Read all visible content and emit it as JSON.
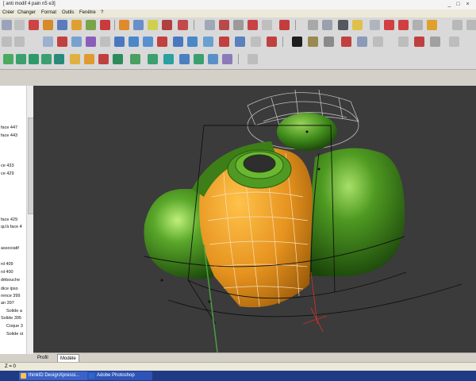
{
  "window": {
    "title": "[ anti modif 4 pain n5 e3]",
    "controls": [
      "_",
      "□",
      "×"
    ]
  },
  "menu": {
    "items": [
      "Créer",
      "Changer",
      "Format",
      "Outils",
      "Fenêtre",
      "?"
    ]
  },
  "tree": {
    "items": [
      "face 447",
      "face 443",
      "ce 433",
      "ce 429",
      "face 429",
      "qu'à face 4",
      "associatif",
      "rd 409",
      "rd 400",
      "débouche",
      "dice ipso",
      "rence 399",
      "an 397",
      "Solide a",
      "Solide 395",
      "Coque 3",
      "Solide st"
    ]
  },
  "tabs": {
    "profil": "Profil",
    "modele": "Modèle"
  },
  "status": {
    "z": "Z = 0"
  },
  "taskbar": {
    "items": [
      "thinkID DesignXpressi...",
      "Adobe Photoshop"
    ]
  },
  "colors": {
    "viewport_bg": "#3b3b3b",
    "model_green": "#3f8a1a",
    "model_orange": "#e6931f",
    "wireframe": "#111111",
    "taskbar": "#1f3b85"
  }
}
